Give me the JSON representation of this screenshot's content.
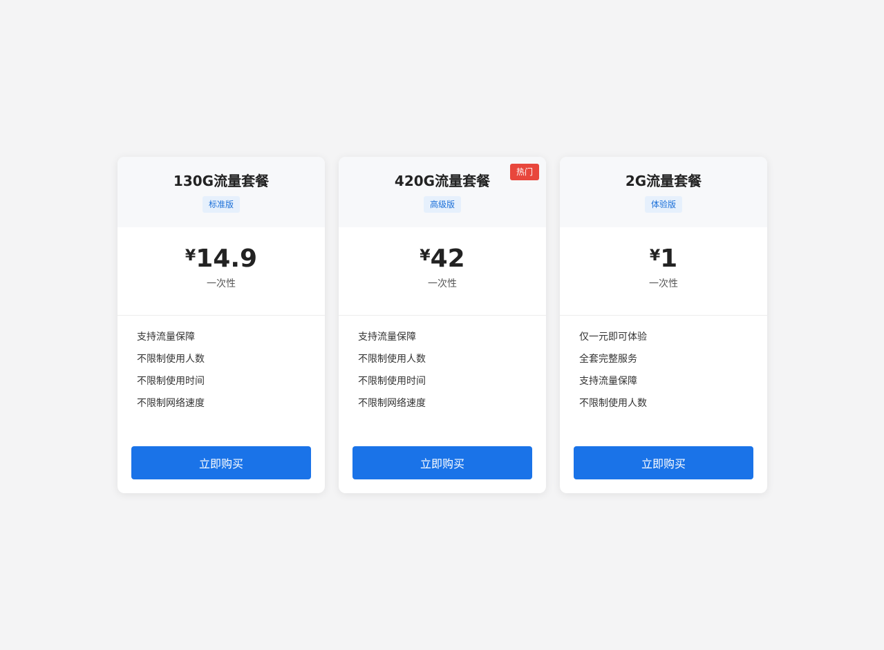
{
  "plans": [
    {
      "title": "130G流量套餐",
      "tier": "标准版",
      "currency": "¥",
      "price": "14.9",
      "period": "一次性",
      "features": [
        "支持流量保障",
        "不限制使用人数",
        "不限制使用时间",
        "不限制网络速度"
      ],
      "button": "立即购买"
    },
    {
      "title": "420G流量套餐",
      "tier": "高级版",
      "badge": "热门",
      "currency": "¥",
      "price": "42",
      "period": "一次性",
      "features": [
        "支持流量保障",
        "不限制使用人数",
        "不限制使用时间",
        "不限制网络速度"
      ],
      "button": "立即购买"
    },
    {
      "title": "2G流量套餐",
      "tier": "体验版",
      "currency": "¥",
      "price": "1",
      "period": "一次性",
      "features": [
        "仅一元即可体验",
        "全套完整服务",
        "支持流量保障",
        "不限制使用人数"
      ],
      "button": "立即购买"
    }
  ],
  "colors": {
    "primary": "#1a73e8",
    "hot_badge": "#e8473c",
    "tier_bg": "#e6f0fc",
    "tier_text": "#1a6fd8",
    "page_bg": "#f4f4f5"
  }
}
